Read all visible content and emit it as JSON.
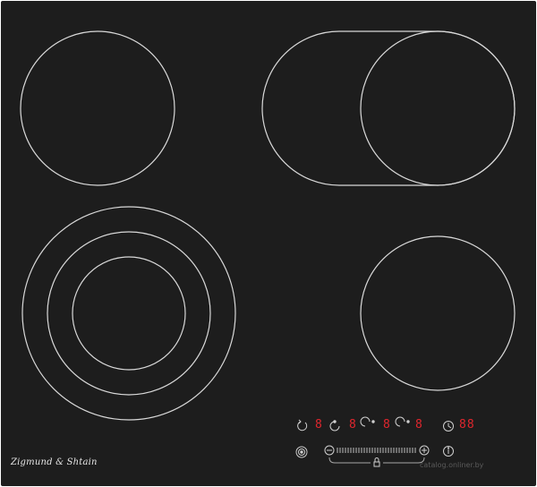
{
  "brand": "Zigmund & Shtain",
  "zone_displays": [
    "8",
    "8",
    "8",
    "8"
  ],
  "timer_display": "88",
  "watermark": "catalog.onliner.by",
  "colors": {
    "panel": "#1d1d1d",
    "zone_outline": "#d9d9d9",
    "display": "#e0262d",
    "control_icon": "#cfcfcf"
  },
  "icons": {
    "power": "power-icon",
    "lock": "lock-icon",
    "minus": "minus-icon",
    "plus": "plus-icon",
    "timer": "timer-icon",
    "info": "info-icon",
    "zone_selectors": [
      "zone-selector-rear-left-icon",
      "zone-selector-rear-right-icon",
      "zone-selector-front-left-icon",
      "zone-selector-front-right-icon"
    ]
  }
}
